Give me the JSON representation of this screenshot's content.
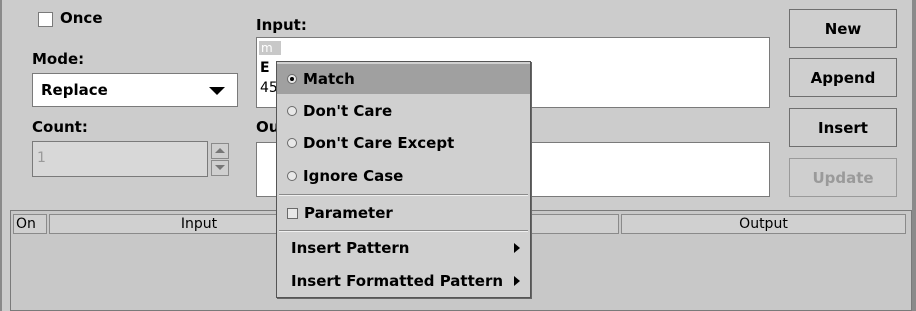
{
  "form": {
    "once_label": "Once",
    "once_checked": false,
    "mode_label": "Mode:",
    "mode_value": "Replace",
    "count_label": "Count:",
    "count_value": "1",
    "input_label": "Input:",
    "input_lines": [
      "m",
      "E",
      "45"
    ],
    "output_label": "Ou"
  },
  "buttons": {
    "new": "New",
    "append": "Append",
    "insert": "Insert",
    "update": "Update"
  },
  "table": {
    "columns": [
      "On",
      "Input",
      "Output"
    ]
  },
  "context_menu": {
    "items": [
      {
        "type": "radio",
        "label": "Match",
        "selected": true
      },
      {
        "type": "radio",
        "label": "Don't Care",
        "selected": false
      },
      {
        "type": "radio",
        "label": "Don't Care Except",
        "selected": false
      },
      {
        "type": "radio",
        "label": "Ignore Case",
        "selected": false
      },
      {
        "type": "check",
        "label": "Parameter",
        "checked": false
      },
      {
        "type": "submenu",
        "label": "Insert Pattern"
      },
      {
        "type": "submenu",
        "label": "Insert Formatted Pattern"
      }
    ]
  }
}
